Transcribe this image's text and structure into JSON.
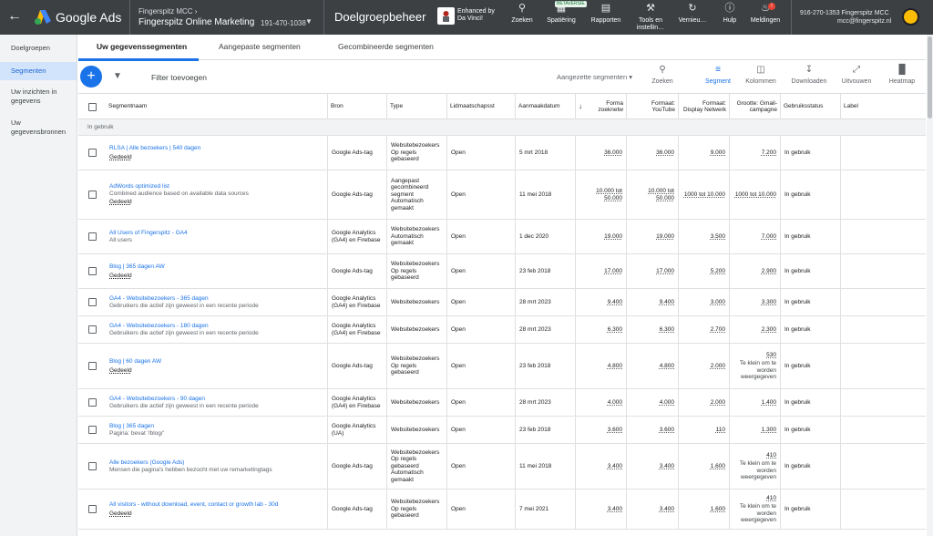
{
  "topbar": {
    "back_icon": "arrow-back-icon",
    "brand": "Google Ads",
    "account_manager": "Fingerspitz MCC",
    "account_name": "Fingerspitz Online Marketing",
    "account_id": "191-470-1038",
    "page_title": "Doelgroepbeheer",
    "enhanced_text": "Enhanced by Da Vinci!",
    "beta_badge": "BETAVERSIE",
    "nav": [
      {
        "label": "Zoeken",
        "icon": "search-icon"
      },
      {
        "label": "Spatiëring",
        "icon": "appearance-icon"
      },
      {
        "label": "Rapporten",
        "icon": "reports-icon"
      },
      {
        "label": "Tools en instellin…",
        "icon": "tools-icon"
      },
      {
        "label": "Vernieu…",
        "icon": "refresh-icon"
      },
      {
        "label": "Hulp",
        "icon": "help-icon"
      },
      {
        "label": "Meldingen",
        "icon": "bell-icon"
      }
    ],
    "notif_count": "!",
    "user_account": "916-270-1353 Fingerspitz MCC",
    "user_email": "mcc@fingerspitz.nl"
  },
  "sidebar": {
    "items": [
      {
        "label": "Doelgroepen"
      },
      {
        "label": "Segmenten"
      },
      {
        "label": "Uw inzichten in gegevens"
      },
      {
        "label": "Uw gegevensbronnen"
      }
    ]
  },
  "tabs": [
    {
      "label": "Uw gegevenssegmenten"
    },
    {
      "label": "Aangepaste segmenten"
    },
    {
      "label": "Gecombineerde segmenten"
    }
  ],
  "toolbar": {
    "filter_label": "Filter toevoegen",
    "segment_select": "Aangezette segmenten",
    "tools": [
      {
        "label": "Zoeken",
        "icon": "search-icon"
      },
      {
        "label": "Segment",
        "icon": "segment-icon"
      },
      {
        "label": "Kolommen",
        "icon": "columns-icon"
      },
      {
        "label": "Downloaden",
        "icon": "download-icon"
      },
      {
        "label": "Uitvouwen",
        "icon": "expand-icon"
      },
      {
        "label": "Heatmap",
        "icon": "heatmap-icon"
      }
    ]
  },
  "table": {
    "headers": {
      "name": "Segmentnaam",
      "source": "Bron",
      "type": "Type",
      "membership": "Lidmaatschapsst",
      "created": "Aanmaakdatum",
      "fmt_search": "Forma zoeknetw",
      "fmt_youtube": "Formaat: YouTube",
      "fmt_display": "Formaat: Display Netwerk",
      "size_gmail": "Grootte: Gmail-campagne",
      "usage": "Gebruiksstatus",
      "label": "Label"
    },
    "group_label": "In gebruik",
    "rows": [
      {
        "name": "RLSA | Alle bezoekers | 540 dagen",
        "desc": "",
        "shared": "Gedeeld",
        "source": "Google Ads-tag",
        "type": "Websitebezoekers Op regels gebaseerd",
        "membership": "Open",
        "created": "5 mrt 2018",
        "search": "36.000",
        "youtube": "36.000",
        "display": "9.000",
        "gmail": "7.200",
        "gmail_note": "",
        "usage": "In gebruik"
      },
      {
        "name": "AdWords optimized list",
        "desc": "Combined audience based on available data sources",
        "shared": "Gedeeld",
        "source": "Google Ads-tag",
        "type": "Aangepast gecombineerd segment Automatisch gemaakt",
        "membership": "Open",
        "created": "11 mei 2018",
        "search": "10.000 tot 50.000",
        "youtube": "10.000 tot 50.000",
        "display": "1000 tot 10.000",
        "gmail": "1000 tot 10.000",
        "gmail_note": "",
        "usage": "In gebruik"
      },
      {
        "name": "All Users of Fingerspitz - GA4",
        "desc": "All users",
        "shared": "",
        "source": "Google Analytics (GA4) en Firebase",
        "type": "Websitebezoekers Automatisch gemaakt",
        "membership": "Open",
        "created": "1 dec 2020",
        "search": "19.000",
        "youtube": "19.000",
        "display": "3.500",
        "gmail": "7.000",
        "gmail_note": "",
        "usage": "In gebruik"
      },
      {
        "name": "Blog | 365 dagen AW",
        "desc": "",
        "shared": "Gedeeld",
        "source": "Google Ads-tag",
        "type": "Websitebezoekers Op regels gebaseerd",
        "membership": "Open",
        "created": "23 feb 2018",
        "search": "17.000",
        "youtube": "17.000",
        "display": "5.200",
        "gmail": "2.900",
        "gmail_note": "",
        "usage": "In gebruik"
      },
      {
        "name": "GA4 - Websitebezoekers - 365 dagen",
        "desc": "Gebruikers die actief zijn geweest in een recente periode",
        "shared": "",
        "source": "Google Analytics (GA4) en Firebase",
        "type": "Websitebezoekers",
        "membership": "Open",
        "created": "28 mrt 2023",
        "search": "9.400",
        "youtube": "9.400",
        "display": "3.000",
        "gmail": "3.300",
        "gmail_note": "",
        "usage": "In gebruik"
      },
      {
        "name": "GA4 - Websitebezoekers - 180 dagen",
        "desc": "Gebruikers die actief zijn geweest in een recente periode",
        "shared": "",
        "source": "Google Analytics (GA4) en Firebase",
        "type": "Websitebezoekers",
        "membership": "Open",
        "created": "28 mrt 2023",
        "search": "6.300",
        "youtube": "6.300",
        "display": "2.700",
        "gmail": "2.300",
        "gmail_note": "",
        "usage": "In gebruik"
      },
      {
        "name": "Blog | 60 dagen AW",
        "desc": "",
        "shared": "Gedeeld",
        "source": "Google Ads-tag",
        "type": "Websitebezoekers Op regels gebaseerd",
        "membership": "Open",
        "created": "23 feb 2018",
        "search": "4.800",
        "youtube": "4.800",
        "display": "2.000",
        "gmail": "530",
        "gmail_note": "Te klein om te worden weergegeven",
        "usage": "In gebruik"
      },
      {
        "name": "GA4 - Websitebezoekers - 90 dagen",
        "desc": "Gebruikers die actief zijn geweest in een recente periode",
        "shared": "",
        "source": "Google Analytics (GA4) en Firebase",
        "type": "Websitebezoekers",
        "membership": "Open",
        "created": "28 mrt 2023",
        "search": "4.000",
        "youtube": "4.000",
        "display": "2.000",
        "gmail": "1.400",
        "gmail_note": "",
        "usage": "In gebruik"
      },
      {
        "name": "Blog | 365 dagen",
        "desc": "Pagina: bevat '/blog/'",
        "shared": "",
        "source": "Google Analytics (UA)",
        "type": "Websitebezoekers",
        "membership": "Open",
        "created": "23 feb 2018",
        "search": "3.600",
        "youtube": "3.600",
        "display": "110",
        "gmail": "1.300",
        "gmail_note": "",
        "usage": "In gebruik"
      },
      {
        "name": "Alle bezoekers (Google Ads)",
        "desc": "Mensen die pagina's hebben bezocht met uw remarketingtags",
        "shared": "",
        "source": "Google Ads-tag",
        "type": "Websitebezoekers Op regels gebaseerd Automatisch gemaakt",
        "membership": "Open",
        "created": "11 mei 2018",
        "search": "3.400",
        "youtube": "3.400",
        "display": "1.600",
        "gmail": "410",
        "gmail_note": "Te klein om te worden weergegeven",
        "usage": "In gebruik"
      },
      {
        "name": "All visitors - without download, event, contact or growth lab - 30d",
        "desc": "",
        "shared": "Gedeeld",
        "source": "Google Ads-tag",
        "type": "Websitebezoekers Op regels gebaseerd",
        "membership": "Open",
        "created": "7 mei 2021",
        "search": "3.400",
        "youtube": "3.400",
        "display": "1.600",
        "gmail": "410",
        "gmail_note": "Te klein om te worden weergegeven",
        "usage": "In gebruik"
      }
    ]
  }
}
